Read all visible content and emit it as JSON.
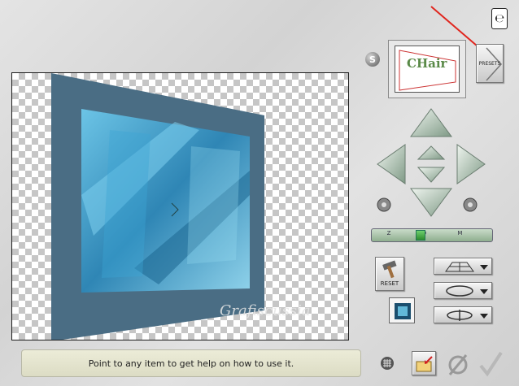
{
  "help": {
    "text": "Point to any item to get help on how to use it."
  },
  "presets": {
    "label": "PRESETS"
  },
  "zoom": {
    "label": "Z O M",
    "level": 0.4
  },
  "reset": {
    "label": "RESET"
  },
  "style_button": {
    "label": "S"
  },
  "thumbnail": {
    "text": "CHair"
  },
  "watermark": {
    "text": "Grafiscussia"
  },
  "colors": {
    "accent_arrow": "#e0261e",
    "preview_dark": "#4a6d84",
    "preview_light": "#5fb8dc"
  }
}
